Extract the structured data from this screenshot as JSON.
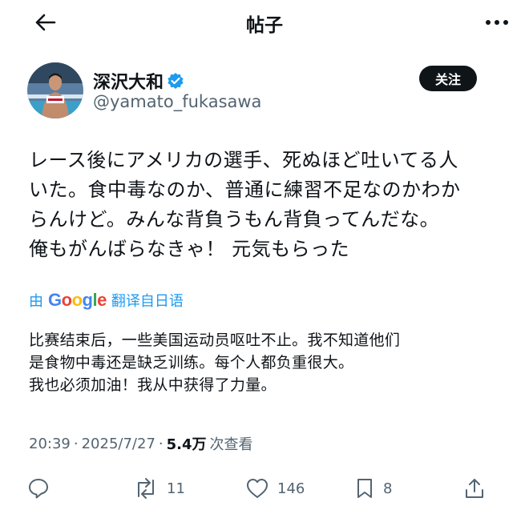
{
  "header": {
    "title": "帖子",
    "back_icon": "arrow-left-icon",
    "more_icon": "more-dots-icon"
  },
  "author": {
    "display_name": "深沢大和",
    "handle": "@yamato_fukasawa",
    "verified_icon": "verified-badge-icon",
    "verified_color": "#1d9bf0",
    "follow_label": "关注"
  },
  "post": {
    "lines": [
      "レース後にアメリカの選手、死ぬほど吐いてる人",
      "いた。食中毒なのか、普通に練習不足なのかわか",
      "らんけど。みんな背負うもん背負ってんだな。",
      "俺もがんばらなきゃ！ 元気もらった"
    ]
  },
  "translation": {
    "prefix": "由",
    "provider": "Google",
    "suffix": "翻译自日语",
    "lines": [
      "比赛结束后，一些美国运动员呕吐不止。我不知道他们",
      "是食物中毒还是缺乏训练。每个人都负重很大。",
      "我也必须加油！我从中获得了力量。"
    ]
  },
  "meta": {
    "time": "20:39",
    "sep1": "·",
    "date": "2025/7/27",
    "sep2": "·",
    "views": "5.4万",
    "views_label": "次查看"
  },
  "actions": {
    "reply": {
      "icon": "reply-icon",
      "count": ""
    },
    "repost": {
      "icon": "repost-icon",
      "count": "11"
    },
    "like": {
      "icon": "heart-icon",
      "count": "146"
    },
    "bookmark": {
      "icon": "bookmark-icon",
      "count": "8"
    },
    "share": {
      "icon": "share-icon",
      "count": ""
    }
  },
  "colors": {
    "accent": "#1d9bf0",
    "text": "#0f1419",
    "muted": "#536471"
  }
}
